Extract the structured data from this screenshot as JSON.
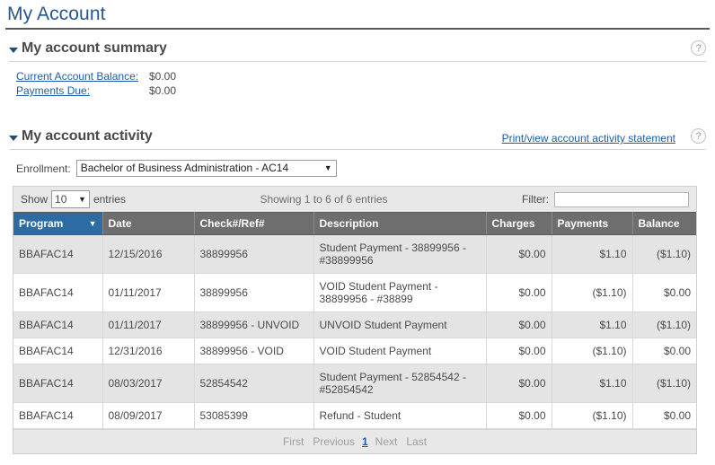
{
  "page": {
    "title": "My Account"
  },
  "summary_section": {
    "title": "My account summary",
    "collapse_icon": "triangle-down-icon",
    "help_icon": "?",
    "rows": [
      {
        "label": "Current Account Balance:",
        "value": "$0.00"
      },
      {
        "label": "Payments Due:",
        "value": "$0.00"
      }
    ]
  },
  "activity_section": {
    "title": "My account activity",
    "collapse_icon": "triangle-down-icon",
    "help_icon": "?",
    "print_link": "Print/view account activity statement",
    "enrollment": {
      "label": "Enrollment:",
      "selected": "Bachelor of Business Administration - AC14",
      "caret_icon": "chevron-down-icon"
    }
  },
  "datatable": {
    "show_label": "Show",
    "entries_label": "entries",
    "page_length": "10",
    "length_caret_icon": "chevron-down-icon",
    "info": "Showing 1 to 6 of 6 entries",
    "filter_label": "Filter:",
    "filter_value": "",
    "filter_placeholder": "",
    "columns": [
      {
        "label": "Program",
        "sorted": true,
        "sort_icon": "sort-desc-icon"
      },
      {
        "label": "Date",
        "sorted": false,
        "sort_icon": ""
      },
      {
        "label": "Check#/Ref#",
        "sorted": false,
        "sort_icon": ""
      },
      {
        "label": "Description",
        "sorted": false,
        "sort_icon": ""
      },
      {
        "label": "Charges",
        "sorted": false,
        "sort_icon": ""
      },
      {
        "label": "Payments",
        "sorted": false,
        "sort_icon": ""
      },
      {
        "label": "Balance",
        "sorted": false,
        "sort_icon": ""
      }
    ],
    "rows": [
      {
        "program": "BBAFAC14",
        "date": "12/15/2016",
        "check": "38899956",
        "description": "Student Payment - 38899956 - #38899956",
        "charges": "$0.00",
        "payments": "$1.10",
        "balance": "($1.10)"
      },
      {
        "program": "BBAFAC14",
        "date": "01/11/2017",
        "check": "38899956",
        "description": "VOID Student Payment - 38899956 - #38899",
        "charges": "$0.00",
        "payments": "($1.10)",
        "balance": "$0.00"
      },
      {
        "program": "BBAFAC14",
        "date": "01/11/2017",
        "check": "38899956 - UNVOID",
        "description": "UNVOID Student Payment",
        "charges": "$0.00",
        "payments": "$1.10",
        "balance": "($1.10)"
      },
      {
        "program": "BBAFAC14",
        "date": "12/31/2016",
        "check": "38899956 - VOID",
        "description": "VOID Student Payment",
        "charges": "$0.00",
        "payments": "($1.10)",
        "balance": "$0.00"
      },
      {
        "program": "BBAFAC14",
        "date": "08/03/2017",
        "check": "52854542",
        "description": "Student Payment - 52854542 - #52854542",
        "charges": "$0.00",
        "payments": "$1.10",
        "balance": "($1.10)"
      },
      {
        "program": "BBAFAC14",
        "date": "08/09/2017",
        "check": "53085399",
        "description": "Refund - Student",
        "charges": "$0.00",
        "payments": "($1.10)",
        "balance": "$0.00"
      }
    ],
    "pagination": {
      "first": "First",
      "previous": "Previous",
      "current_page": "1",
      "next": "Next",
      "last": "Last"
    }
  },
  "colors": {
    "title_blue": "#27578f",
    "link_blue": "#1c5ca8",
    "header_gray": "#6e6e6e",
    "sorted_header_blue": "#2d6ca2",
    "row_odd": "#e4e4e4"
  }
}
